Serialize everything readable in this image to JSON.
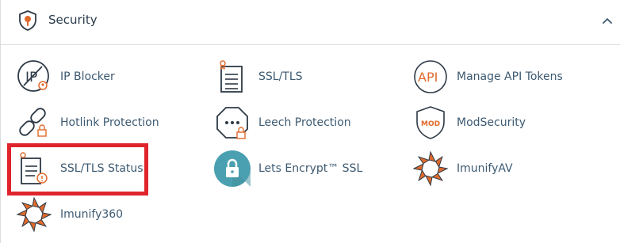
{
  "section": {
    "title": "Security",
    "icon": "shield-icon",
    "collapse_icon": "chevron-up-icon"
  },
  "colors": {
    "accent_orange": "#e06a2c",
    "dark_icon": "#2e3a46",
    "teal": "#4aa0b0",
    "highlight_red": "#e0242c"
  },
  "items": [
    {
      "label": "IP Blocker",
      "icon": "ip-blocker-icon"
    },
    {
      "label": "SSL/TLS",
      "icon": "certificate-icon"
    },
    {
      "label": "Manage API Tokens",
      "icon": "api-icon"
    },
    {
      "label": "Hotlink Protection",
      "icon": "chain-link-icon"
    },
    {
      "label": "Leech Protection",
      "icon": "octagon-dots-icon"
    },
    {
      "label": "ModSecurity",
      "icon": "mod-shield-icon"
    },
    {
      "label": "SSL/TLS Status",
      "icon": "certificate-status-icon"
    },
    {
      "label": "Lets Encrypt™ SSL",
      "icon": "padlock-icon"
    },
    {
      "label": "ImunifyAV",
      "icon": "imunify-icon"
    },
    {
      "label": "Imunify360",
      "icon": "imunify-icon"
    }
  ]
}
